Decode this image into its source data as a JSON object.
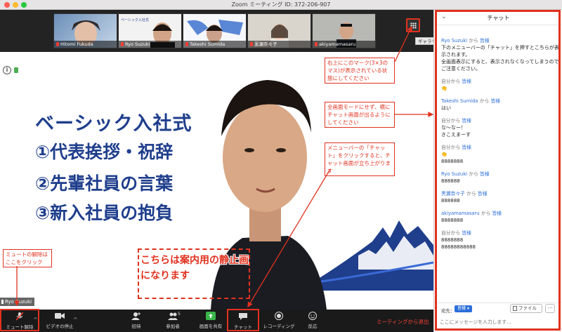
{
  "window": {
    "title": "Zoom ミーティング ID: 372-206-907"
  },
  "gallery": {
    "thumbnails": [
      {
        "name": "Hitomi Fukuda"
      },
      {
        "name": "Ryo Suzuki"
      },
      {
        "name": "Takeshi Sumida"
      },
      {
        "name": "黒瀬奈々子"
      },
      {
        "name": "akiyamamasaru"
      }
    ],
    "tooltip": "ギャラリービュー"
  },
  "slide": {
    "lines": [
      "ベーシック入社式",
      "①代表挨拶・祝辞",
      "②先輩社員の言葉",
      "③新入社員の抱負"
    ],
    "thumb_text": "ベーシック入社式\n①代表挨拶・祝辞\n②先輩社員の言葉\n③新入社員の抱負"
  },
  "static_label": "こちらは案内用の静止画になります",
  "speaker_name": "Ryo Suzuki",
  "annotations": {
    "gallery_mark": "右上にこのマーク(3×3のマス)が表示されている状態にしてください",
    "no_fullscreen": "全画面モードにせず、横にチャット画面が出るようにしてください",
    "chat_button": "メニューバーの「チャット」をクリックすると、チャット画面が立ち上がります",
    "unmute": "ミュートの解除はここをクリック"
  },
  "toolbar": {
    "unmute": "ミュート解除",
    "video_stop": "ビデオの停止",
    "invite": "招待",
    "participants": "参加者",
    "participants_count": "5",
    "share": "画面を共有",
    "chat": "チャット",
    "record": "レコーディング",
    "reactions": "反応",
    "leave": "ミーティングから退出"
  },
  "chat": {
    "title": "チャット",
    "messages": [
      {
        "from": "Ryo Suzuki",
        "from_word": "から",
        "to": "皆様",
        "text": "下のメニューバーの「チャット」を押すとこちらが表示されます。\n全画面表示にすると、表示されなくなってしまうのでご注意ください。"
      },
      {
        "from": "自分から",
        "from_word": "",
        "to": "皆様",
        "text": "👏"
      },
      {
        "from": "Takeshi Sumida",
        "from_word": "から",
        "to": "皆様",
        "text": "はい"
      },
      {
        "from": "自分から",
        "from_word": "",
        "to": "皆様",
        "text": "な〜なー！\nきこえまーす"
      },
      {
        "from": "自分から",
        "from_word": "",
        "to": "皆様",
        "text": "👏\n8888888"
      },
      {
        "from": "Ryo Suzuki",
        "from_word": "から",
        "to": "皆様",
        "text": "888888"
      },
      {
        "from": "黒瀬奈々子",
        "from_word": "から",
        "to": "皆様",
        "text": "888888"
      },
      {
        "from": "akiyamamasaru",
        "from_word": "から",
        "to": "皆様",
        "text": "8888888"
      },
      {
        "from": "自分から",
        "from_word": "",
        "to": "皆様",
        "text": "8888888\n88888888888"
      }
    ],
    "to_label": "宛先：",
    "to_value": "皆様",
    "file_button": "ファイル",
    "more_button": "···",
    "input_placeholder": "ここにメッセージを入力します..."
  },
  "colors": {
    "annotation": "#e0321f",
    "link": "#2d6fd8",
    "leave": "#ff453a"
  }
}
